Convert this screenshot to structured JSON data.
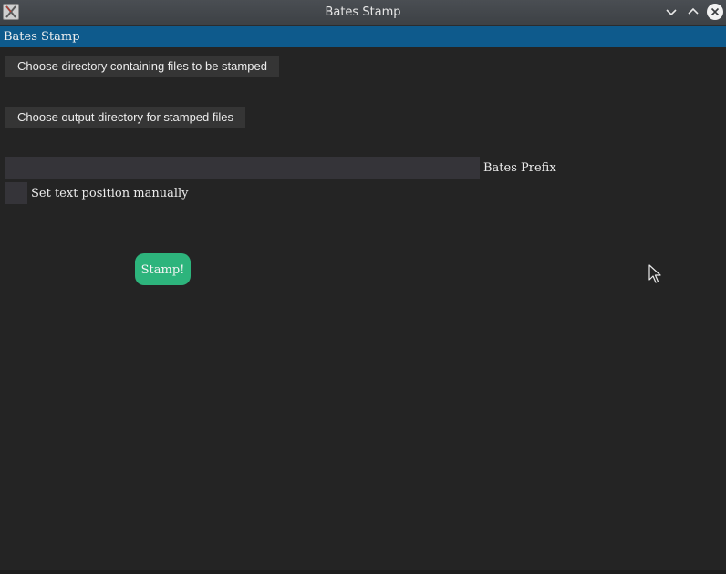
{
  "window": {
    "title": "Bates Stamp",
    "icon": "x-app-icon"
  },
  "header": {
    "label": "Bates Stamp",
    "color": "#0e5a8c"
  },
  "form": {
    "input_dir_button": "Choose directory containing files to be stamped",
    "output_dir_button": "Choose output directory for stamped files",
    "prefix_value": "",
    "prefix_label": "Bates Prefix",
    "manual_position_label": "Set text position manually",
    "manual_position_checked": false,
    "stamp_button": "Stamp!",
    "stamp_color": "#2db47c"
  }
}
